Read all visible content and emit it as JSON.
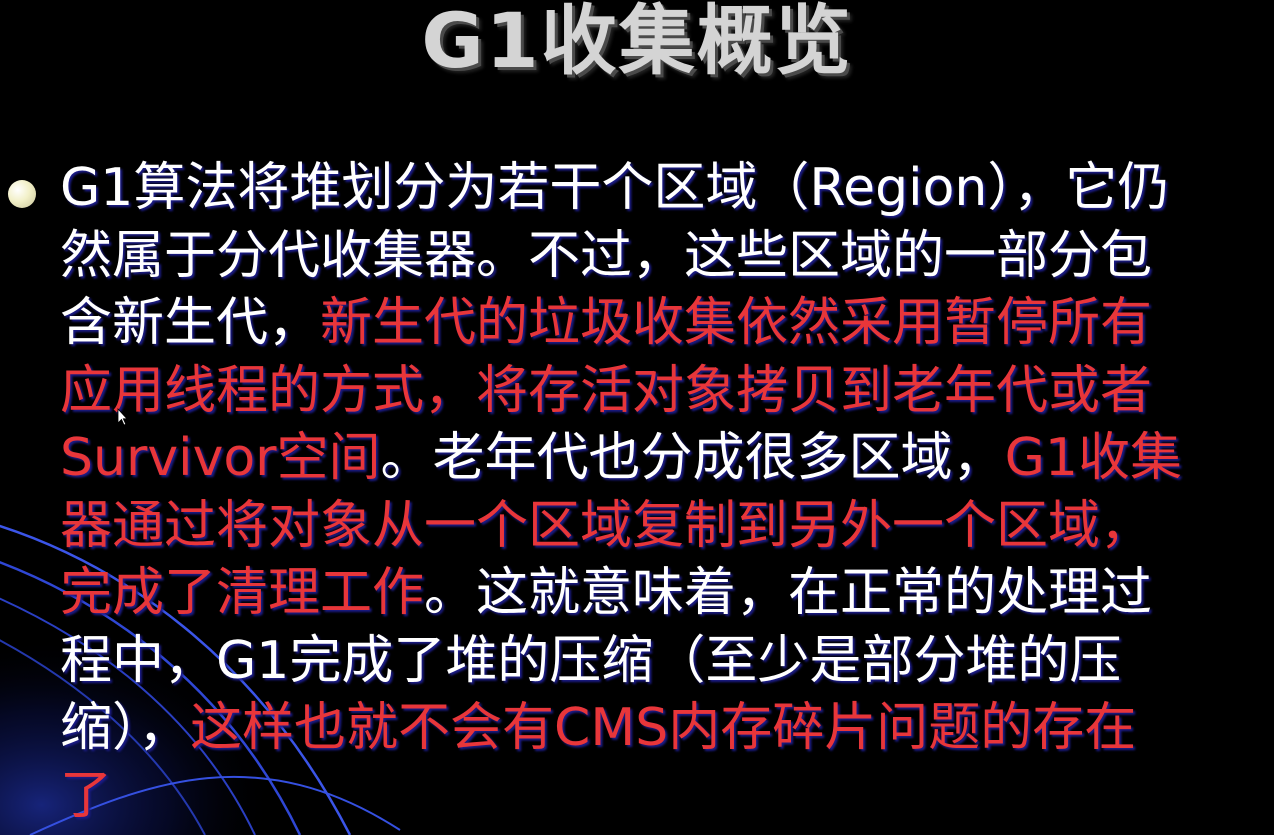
{
  "slide": {
    "title": "G1收集概览",
    "lines": [
      [
        {
          "text": "G1算法将堆划分为若干个区域（Region），它仍",
          "color": "white"
        }
      ],
      [
        {
          "text": "然属于分代收集器。不过，这些区域的一部分包",
          "color": "white"
        }
      ],
      [
        {
          "text": "含新生代，",
          "color": "white"
        },
        {
          "text": "新生代的垃圾收集依然采用暂停所有",
          "color": "red"
        }
      ],
      [
        {
          "text": "应用线程的方式，将存活对象拷贝到老年代或者",
          "color": "red"
        }
      ],
      [
        {
          "text": "Survivor空间",
          "color": "red"
        },
        {
          "text": "。老年代也分成很多区域，",
          "color": "white"
        },
        {
          "text": "G1收集",
          "color": "red"
        }
      ],
      [
        {
          "text": "器通过将对象从一个区域复制到另外一个区域，",
          "color": "red"
        }
      ],
      [
        {
          "text": "完成了清理工作",
          "color": "red"
        },
        {
          "text": "。这就意味着，在正常的处理过",
          "color": "white"
        }
      ],
      [
        {
          "text": "程中，G1完成了堆的压缩（至少是部分堆的压",
          "color": "white"
        }
      ],
      [
        {
          "text": "缩），",
          "color": "white"
        },
        {
          "text": "这样也就不会有CMS内存碎片问题的存在",
          "color": "red"
        }
      ],
      [
        {
          "text": "了",
          "color": "red"
        }
      ]
    ]
  },
  "colors": {
    "background": "#000000",
    "title": "#d4d4d4",
    "text_white": "#ffffff",
    "text_red": "#e8363a",
    "decor_arc": "#2b3fd6"
  }
}
